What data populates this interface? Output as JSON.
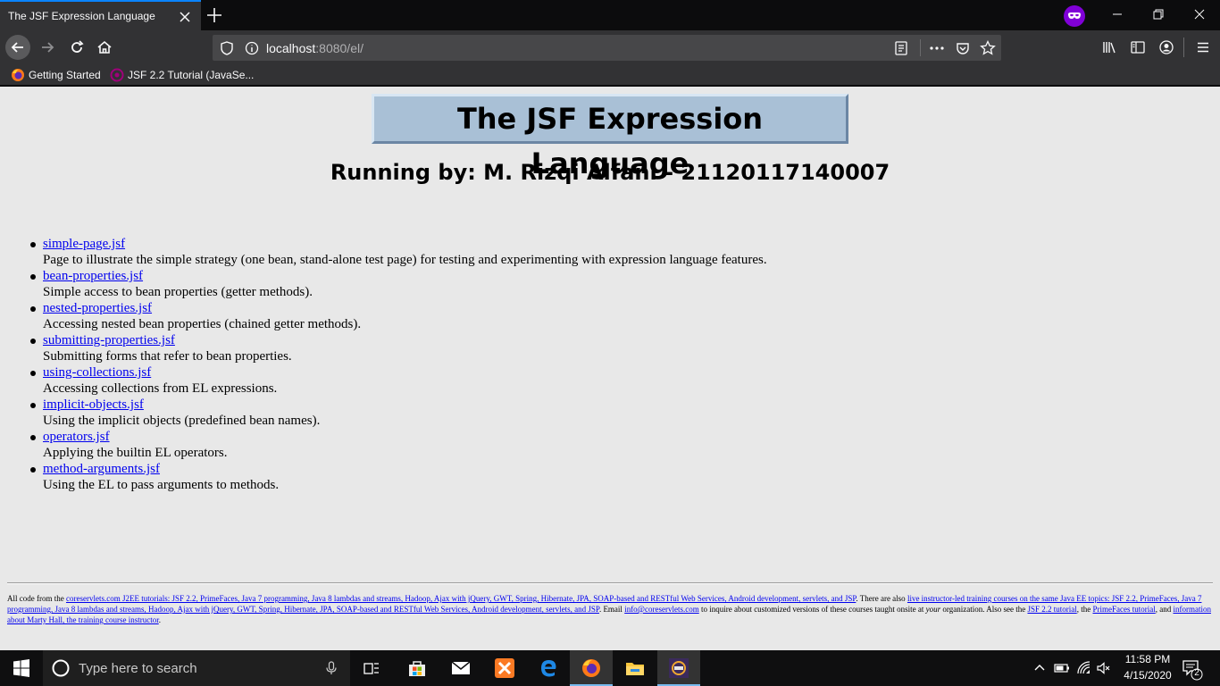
{
  "browser": {
    "tab_title": "The JSF Expression Language",
    "url_host": "localhost",
    "url_path": ":8080/el/",
    "bookmarks": [
      {
        "label": "Getting Started",
        "icon": "firefox-icon"
      },
      {
        "label": "JSF 2.2 Tutorial (JavaSe...",
        "icon": "coreservlets-icon"
      }
    ]
  },
  "page": {
    "title": "The JSF Expression Language",
    "subtitle": "Running by: M. Rizqi Alfani - 21120117140007",
    "items": [
      {
        "link": "simple-page.jsf",
        "desc": "Page to illustrate the simple strategy (one bean, stand-alone test page) for testing and experimenting with expression language features."
      },
      {
        "link": "bean-properties.jsf",
        "desc": "Simple access to bean properties (getter methods)."
      },
      {
        "link": "nested-properties.jsf",
        "desc": "Accessing nested bean properties (chained getter methods)."
      },
      {
        "link": "submitting-properties.jsf",
        "desc": "Submitting forms that refer to bean properties."
      },
      {
        "link": "using-collections.jsf",
        "desc": "Accessing collections from EL expressions."
      },
      {
        "link": "implicit-objects.jsf",
        "desc": "Using the implicit objects (predefined bean names)."
      },
      {
        "link": "operators.jsf",
        "desc": "Applying the builtin EL operators."
      },
      {
        "link": "method-arguments.jsf",
        "desc": "Using the EL to pass arguments to methods."
      }
    ],
    "footer": {
      "t1": "All code from the ",
      "l1": "coreservlets.com J2EE tutorials: JSF 2.2, PrimeFaces, Java 7 programming, Java 8 lambdas and streams, Hadoop, Ajax with jQuery, GWT, Spring, Hibernate, JPA, SOAP-based and RESTful Web Services, Android development, servlets, and JSP",
      "t2": ". There are also ",
      "l2": "live instructor-led training courses on the same Java EE topics: JSF 2.2, PrimeFaces, Java 7 programming, Java 8 lambdas and streams, Hadoop, Ajax with jQuery, GWT, Spring, Hibernate, JPA, SOAP-based and RESTful Web Services, Android development, servlets, and JSP",
      "t3": ". Email ",
      "l3": "info@coreservlets.com",
      "t4": " to inquire about customized versions of these courses taught onsite at ",
      "t4i": "your",
      "t5": " organization. Also see the ",
      "l4": "JSF 2.2 tutorial",
      "t6": ", the ",
      "l5": "PrimeFaces tutorial",
      "t7": ", and ",
      "l6": "information about Marty Hall, the training course instructor",
      "t8": "."
    }
  },
  "taskbar": {
    "search_placeholder": "Type here to search",
    "time": "11:58 PM",
    "date": "4/15/2020",
    "notification_count": "2"
  }
}
